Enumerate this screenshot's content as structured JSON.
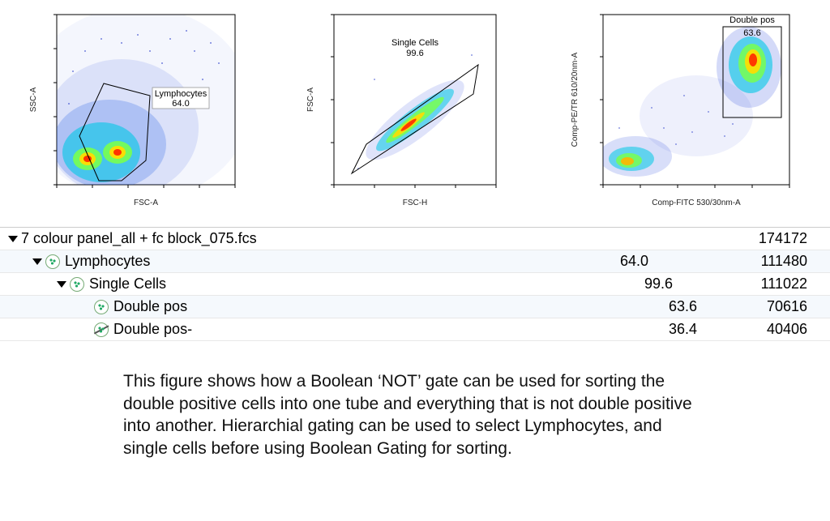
{
  "chart_data": [
    {
      "type": "scatter",
      "title": "",
      "xlabel": "FSC-A",
      "ylabel": "SSC-A",
      "gate": {
        "name": "Lymphocytes",
        "freq": 64.0
      },
      "description": "FSC-A vs SSC-A density, polygonal gate around lymphocyte population (~64%)."
    },
    {
      "type": "scatter",
      "title": "",
      "xlabel": "FSC-H",
      "ylabel": "FSC-A",
      "gate": {
        "name": "Single Cells",
        "freq": 99.6
      },
      "description": "FSC-H vs FSC-A singlet discrimination, diagonal parallelogram gate (~99.6%)."
    },
    {
      "type": "scatter",
      "title": "",
      "xlabel": "Comp-FITC 530/30nm-A",
      "ylabel": "Comp-PE/TR 610/20nm-A",
      "gate": {
        "name": "Double pos",
        "freq": 63.6
      },
      "description": "Biexponential density plot, rectangular gate on double-positive population (~63.6%)."
    }
  ],
  "plots": [
    {
      "xlabel": "FSC-A",
      "ylabel": "SSC-A",
      "gate_name": "Lymphocytes",
      "gate_val": "64.0"
    },
    {
      "xlabel": "FSC-H",
      "ylabel": "FSC-A",
      "gate_name": "Single Cells",
      "gate_val": "99.6"
    },
    {
      "xlabel": "Comp-FITC 530/30nm-A",
      "ylabel": "Comp-PE/TR 610/20nm-A",
      "gate_name": "Double pos",
      "gate_val": "63.6"
    }
  ],
  "table": {
    "rows": [
      {
        "indent": 0,
        "tri": true,
        "icon": "none",
        "name": "7 colour panel_all + fc block_075.fcs",
        "freq": "",
        "count": "174172"
      },
      {
        "indent": 1,
        "tri": true,
        "icon": "pop",
        "name": "Lymphocytes",
        "freq": "64.0",
        "count": "111480"
      },
      {
        "indent": 2,
        "tri": true,
        "icon": "pop",
        "name": "Single Cells",
        "freq": "99.6",
        "count": "111022"
      },
      {
        "indent": 3,
        "tri": false,
        "icon": "pop",
        "name": "Double pos",
        "freq": "63.6",
        "count": "70616"
      },
      {
        "indent": 3,
        "tri": false,
        "icon": "not",
        "name": "Double pos-",
        "freq": "36.4",
        "count": "40406"
      }
    ]
  },
  "caption": "This figure shows how a Boolean ‘NOT’ gate can be used for sorting the double positive cells into one tube and everything that is not double positive into another.  Hierarchial gating can be used to select Lymphocytes, and single cells before using Boolean Gating for sorting."
}
